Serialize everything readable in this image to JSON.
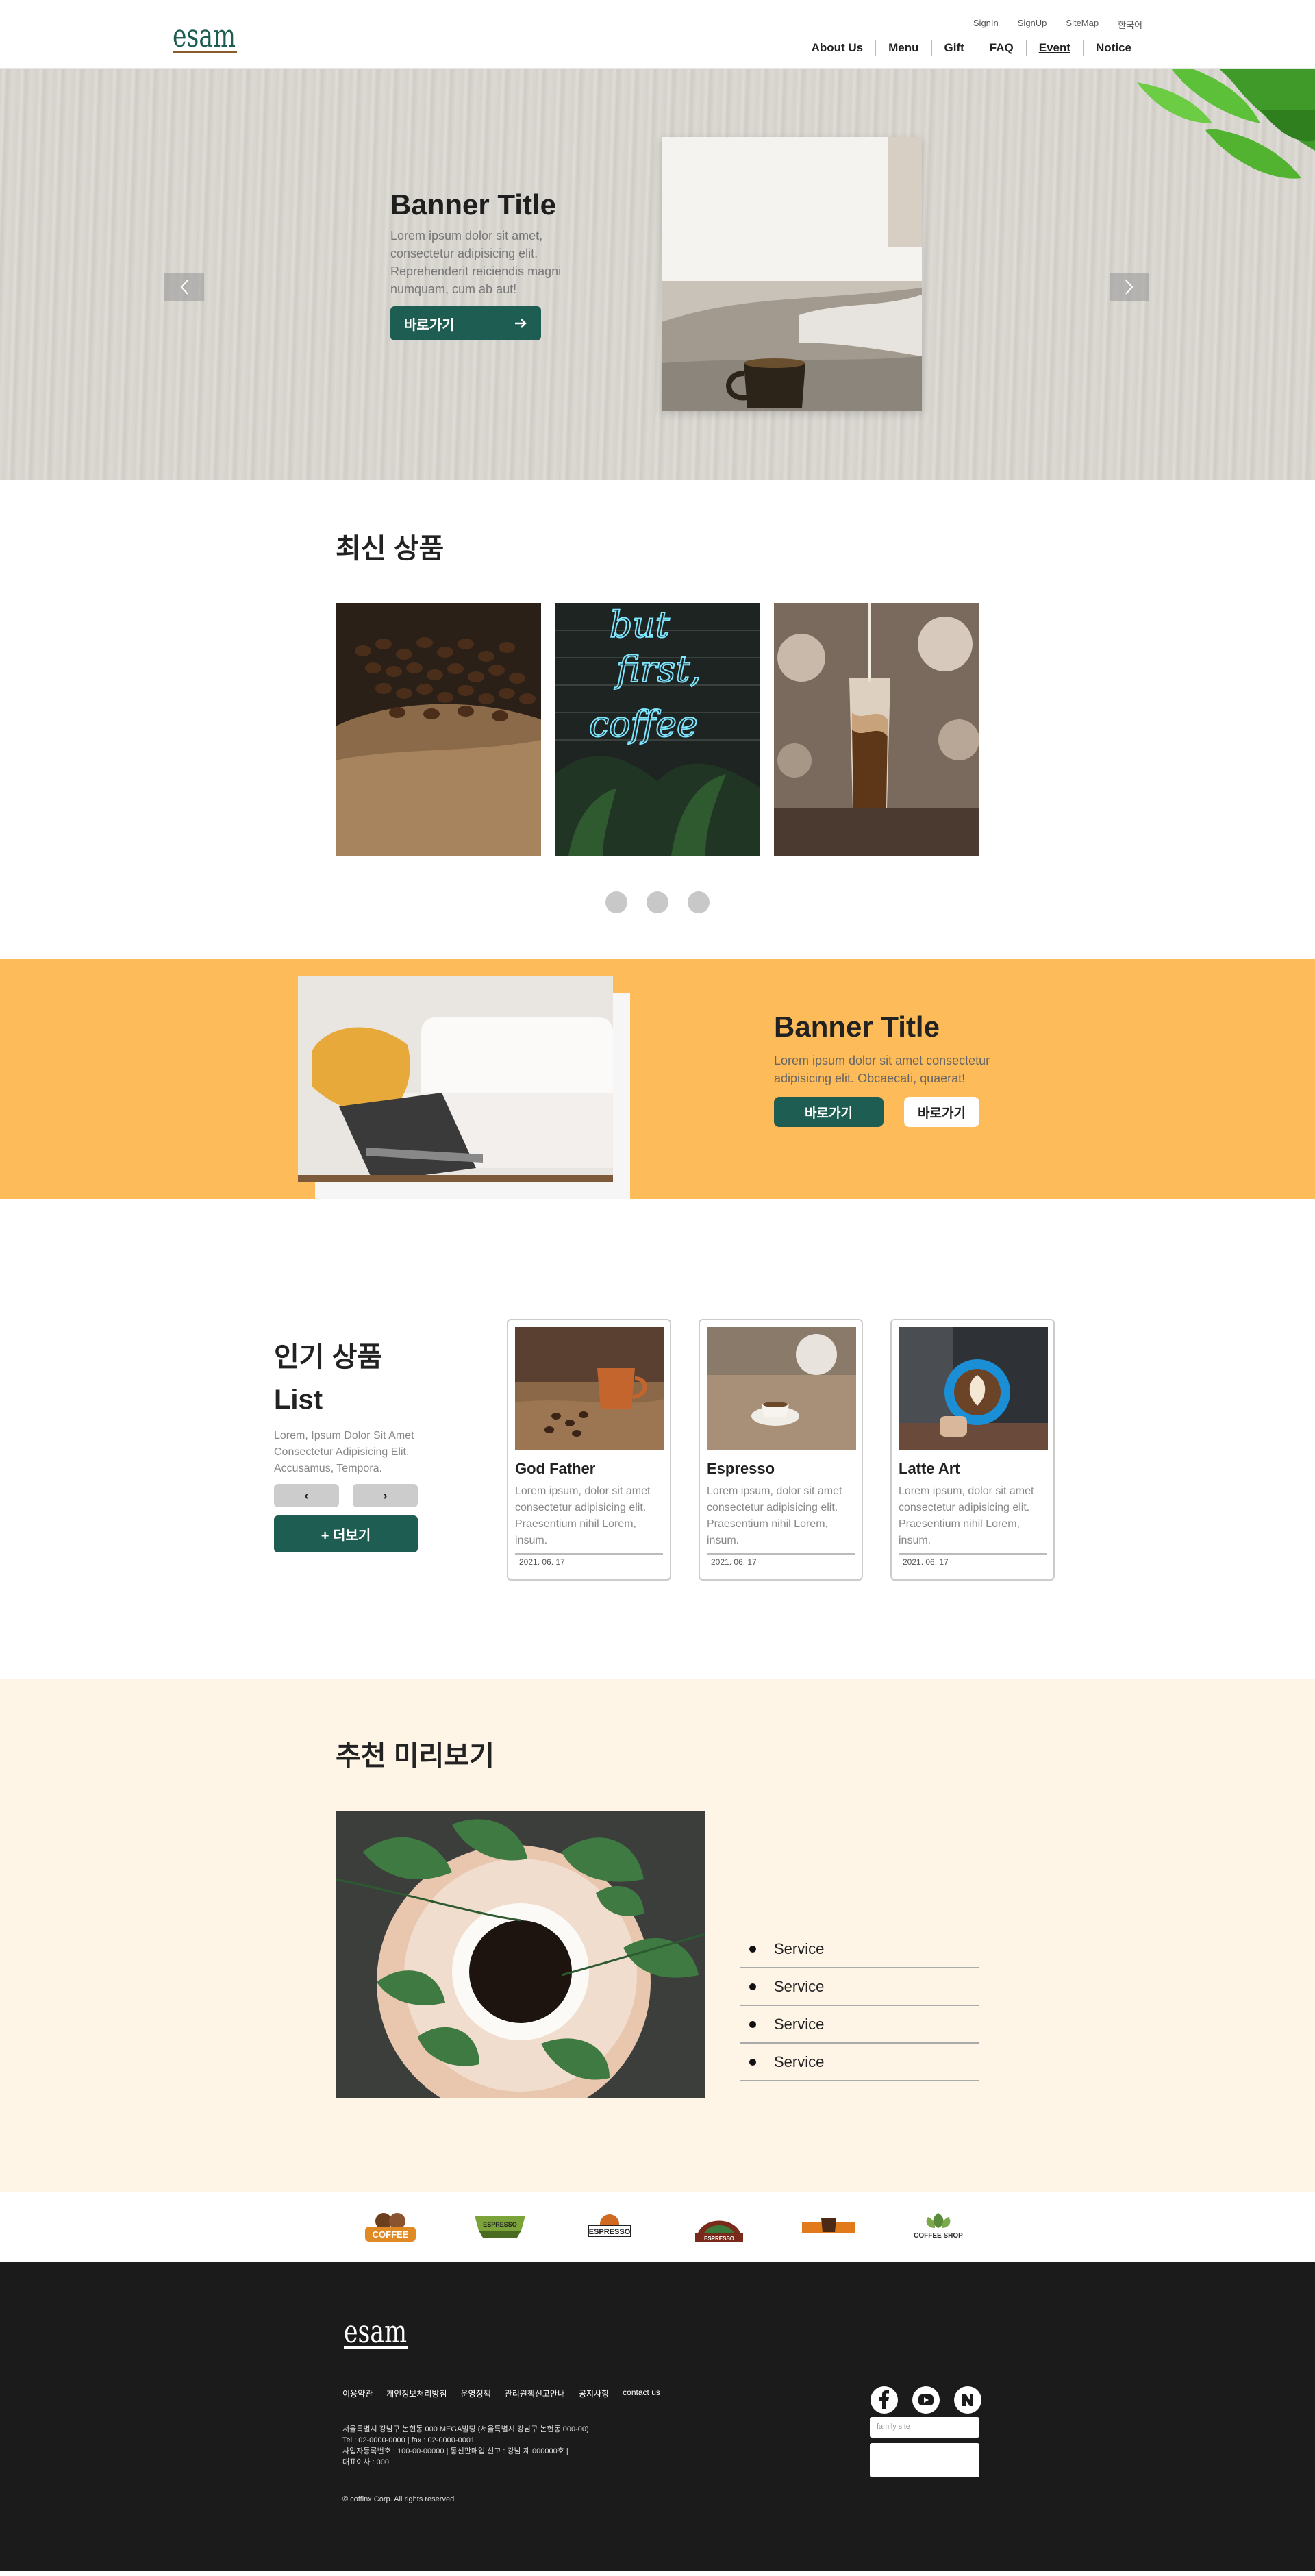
{
  "header": {
    "logo_text": "esam",
    "top_links": [
      "SignIn",
      "SignUp",
      "SiteMap",
      "한국어"
    ],
    "nav": [
      "About Us",
      "Menu",
      "Gift",
      "FAQ",
      "Event",
      "Notice"
    ]
  },
  "hero": {
    "title": "Banner Title",
    "description": "Lorem ipsum dolor sit amet, consectetur adipisicing elit. Reprehenderit reiciendis magni numquam, cum ab aut!",
    "button": "바로가기",
    "prev_icon": "chevron-left-icon",
    "next_icon": "chevron-right-icon"
  },
  "new_products": {
    "title": "최신 상품",
    "items": [
      "coffee-beans-photo",
      "neon-but-first-coffee-photo",
      "iced-coffee-photo"
    ],
    "neon_text": [
      "but",
      "first,",
      "coffee"
    ],
    "dots": 3
  },
  "yellow_banner": {
    "title": "Banner Title",
    "description": "Lorem ipsum dolor sit amet consectetur adipisicing elit. Obcaecati, quaerat!",
    "button_primary": "바로가기",
    "button_secondary": "바로가기"
  },
  "popular": {
    "title_line1": "인기 상품",
    "title_line2": "List",
    "description": "Lorem, Ipsum Dolor Sit Amet Consectetur Adipisicing Elit. Accusamus, Tempora.",
    "prev": "‹",
    "next": "›",
    "more_button": "+ 더보기",
    "cards": [
      {
        "title": "God Father",
        "desc": "Lorem ipsum, dolor sit amet consectetur adipisicing elit. Praesentium nihil Lorem, insum.",
        "date": "2021. 06. 17"
      },
      {
        "title": "Espresso",
        "desc": "Lorem ipsum, dolor sit amet consectetur adipisicing elit. Praesentium nihil Lorem, insum.",
        "date": "2021. 06. 17"
      },
      {
        "title": "Latte Art",
        "desc": "Lorem ipsum, dolor sit amet consectetur adipisicing elit. Praesentium nihil Lorem, insum.",
        "date": "2021. 06. 17"
      }
    ]
  },
  "recommend": {
    "title": "추천 미리보기",
    "services": [
      "Service",
      "Service",
      "Service",
      "Service"
    ]
  },
  "brands": {
    "items": [
      "COFFEE",
      "ESPRESSO",
      "ESPRESSO",
      "ESPRESSO",
      "",
      "COFFEE SHOP"
    ]
  },
  "footer": {
    "logo_text": "esam",
    "links": [
      "이용약관",
      "개인정보처리방침",
      "운영정책",
      "관리원책신고안내",
      "공지사항",
      "contact us"
    ],
    "info_line1": "서울특별시 강남구 논현동 000 MEGA빌딩 (서울특별시 강남구 논현동 000-00)",
    "info_line2": "Tel : 02-0000-0000 | fax : 02-0000-0001",
    "info_line3": "사업자등록번호 : 100-00-00000 | 통신판매업 신고 : 강남 제 000000호 |",
    "info_line4": "대표이사 : 000",
    "copyright": "© coffinx Corp. All rights reserved.",
    "family_site_placeholder": "family site",
    "social": [
      "facebook-icon",
      "youtube-icon",
      "naver-icon"
    ]
  }
}
